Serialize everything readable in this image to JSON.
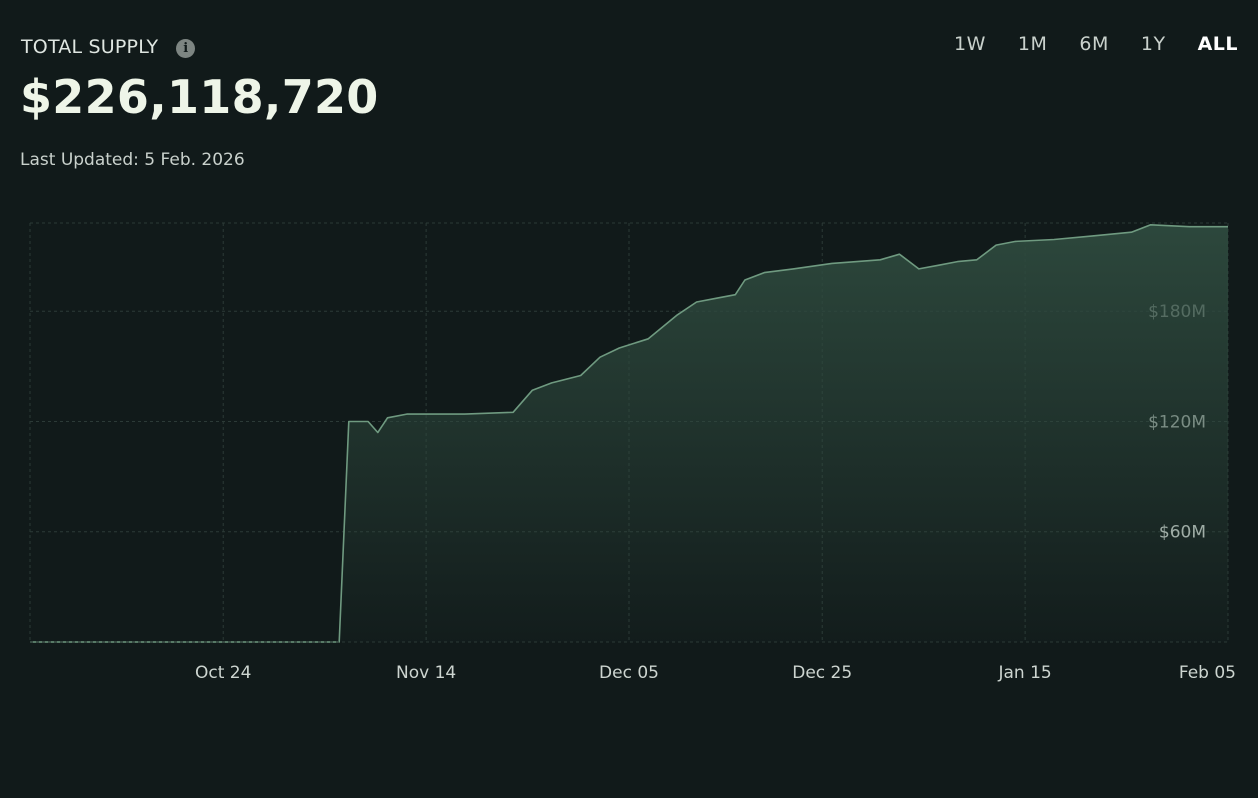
{
  "header": {
    "title": "TOTAL SUPPLY",
    "info_icon": "info-icon",
    "value": "$226,118,720",
    "last_updated": "Last Updated: 5 Feb. 2026"
  },
  "range_selector": {
    "options": [
      "1W",
      "1M",
      "6M",
      "1Y",
      "ALL"
    ],
    "selected": "ALL"
  },
  "colors": {
    "background": "#111a1a",
    "line": "#6f9a80",
    "area_top": "#2e4a3e",
    "grid": "#2c3a37"
  },
  "chart_data": {
    "type": "area",
    "title": "",
    "xlabel": "",
    "ylabel": "",
    "x_ticks": [
      "Oct 24",
      "Nov 14",
      "Dec 05",
      "Dec 25",
      "Jan 15",
      "Feb 05"
    ],
    "x_tick_dates": [
      "2025-10-24",
      "2025-11-14",
      "2025-12-05",
      "2025-12-25",
      "2026-01-15",
      "2026-02-05"
    ],
    "y_ticks": [
      "$60M",
      "$120M",
      "$180M"
    ],
    "y_tick_values": [
      60,
      120,
      180
    ],
    "ylim": [
      0,
      228
    ],
    "xlim": [
      "2025-10-04",
      "2026-02-05"
    ],
    "grid": true,
    "legend": "none",
    "y_unit": "$M",
    "series": [
      {
        "x": [
          "2025-10-04",
          "2025-11-05",
          "2025-11-06",
          "2025-11-08",
          "2025-11-09",
          "2025-11-10",
          "2025-11-12",
          "2025-11-18",
          "2025-11-23",
          "2025-11-25",
          "2025-11-27",
          "2025-11-30",
          "2025-12-02",
          "2025-12-04",
          "2025-12-07",
          "2025-12-10",
          "2025-12-12",
          "2025-12-14",
          "2025-12-16",
          "2025-12-17",
          "2025-12-19",
          "2025-12-22",
          "2025-12-26",
          "2025-12-31",
          "2026-01-02",
          "2026-01-04",
          "2026-01-06",
          "2026-01-08",
          "2026-01-10",
          "2026-01-12",
          "2026-01-14",
          "2026-01-18",
          "2026-01-22",
          "2026-01-26",
          "2026-01-28",
          "2026-02-01",
          "2026-02-05"
        ],
        "values": [
          0,
          0,
          120,
          120,
          114,
          122,
          124,
          124,
          125,
          137,
          141,
          145,
          155,
          160,
          165,
          178,
          185,
          187,
          189,
          197,
          201,
          203,
          206,
          208,
          211,
          203,
          205,
          207,
          208,
          216,
          218,
          219,
          221,
          223,
          227,
          226,
          226
        ]
      }
    ]
  }
}
